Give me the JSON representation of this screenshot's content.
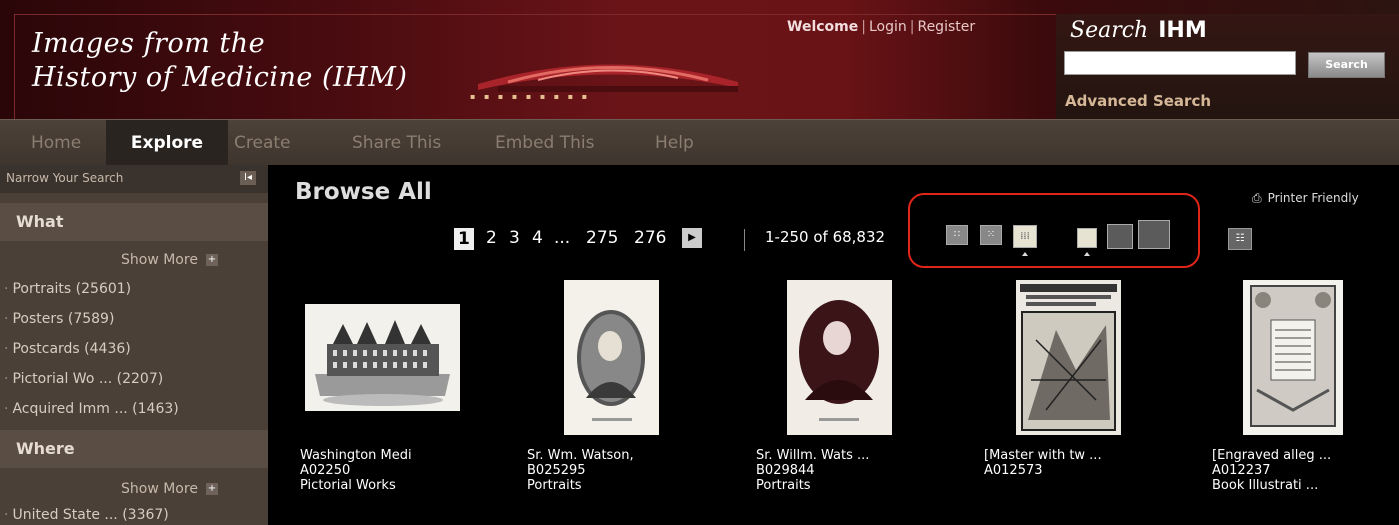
{
  "header": {
    "title_line1": "Images from the",
    "title_line2": "History of Medicine (IHM)"
  },
  "auth": {
    "welcome": "Welcome",
    "login": "Login",
    "register": "Register"
  },
  "search": {
    "label_italic": "Search",
    "label_bold": "IHM",
    "value": "",
    "button": "Search",
    "advanced": "Advanced Search"
  },
  "nav": [
    "Home",
    "Explore",
    "Create",
    "Share This",
    "Embed This",
    "Help"
  ],
  "nav_active": "Explore",
  "sidebar": {
    "header": "Narrow Your Search",
    "collapse_icon": "I◂",
    "what": {
      "title": "What",
      "show_more": "Show More",
      "items": [
        "Portraits (25601)",
        "Posters (7589)",
        "Postcards (4436)",
        "Pictorial Wo ... (2207)",
        "Acquired Imm ... (1463)"
      ]
    },
    "where": {
      "title": "Where",
      "show_more": "Show More",
      "items": [
        "United State ... (3367)"
      ]
    }
  },
  "main": {
    "title": "Browse All",
    "printer_friendly": "Printer Friendly",
    "pager": {
      "current": "1",
      "pages": [
        "2",
        "3",
        "4",
        "...",
        "275",
        "276"
      ]
    },
    "range": "1-250 of 68,832",
    "view_size_options": [
      "small-grid",
      "medium-grid",
      "large-grid"
    ],
    "view_image_options": [
      "image-small",
      "image-medium",
      "image-large"
    ],
    "items": [
      {
        "title": "Washington Medi",
        "id": "A02250",
        "type": "Pictorial Works",
        "image": "building"
      },
      {
        "title": "Sr. Wm. Watson,",
        "id": "B025295",
        "type": "Portraits",
        "image": "portrait-bw"
      },
      {
        "title": "Sr. Willm. Wats ...",
        "id": "B029844",
        "type": "Portraits",
        "image": "portrait-sepia"
      },
      {
        "title": "[Master with tw ...",
        "id": "A012573",
        "type": "",
        "image": "woodcut"
      },
      {
        "title": "[Engraved alleg ...",
        "id": "A012237",
        "type": "Book Illustrati ...",
        "image": "engraving"
      }
    ]
  },
  "colors": {
    "header_red": "#6b1418",
    "nav_bg": "#4d4239",
    "sidebar_bg": "#4b4037",
    "highlight": "#e0251a"
  }
}
